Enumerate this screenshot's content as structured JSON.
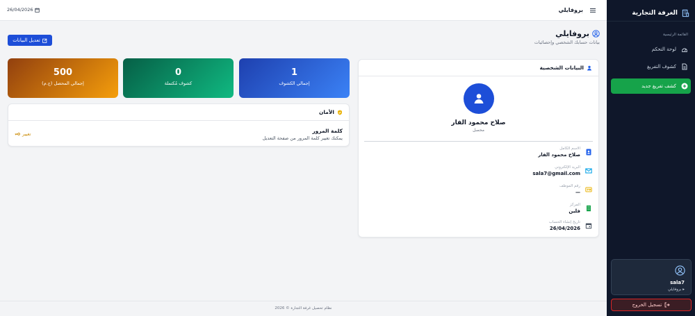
{
  "sidebar": {
    "brand": "الغرفة التجارية",
    "section_label": "القائمة الرئيسية",
    "items": [
      {
        "label": "لوحة التحكم",
        "icon": "dashboard-icon"
      },
      {
        "label": "كشوف التفريغ",
        "icon": "document-icon"
      },
      {
        "label": "كشف تفريغ جديد",
        "icon": "plus-circle-icon"
      }
    ],
    "user": {
      "name": "sala7",
      "profile_link": "بروفايلي"
    },
    "logout_label": "تسجيل الخروج"
  },
  "topbar": {
    "title": "بروفايلي",
    "date": "26/04/2026"
  },
  "page": {
    "title": "بروفايلي",
    "subtitle": "بيانات حسابك الشخصي وإحصائيات",
    "edit_button": "تعديل البيانات"
  },
  "personal": {
    "heading": "البيانات الشخصية",
    "name": "صلاح محمود الفار",
    "role": "محصل",
    "fields": [
      {
        "label": "الاسم الكامل",
        "value": "صلاح محمود الفار",
        "icon": "id-card-icon"
      },
      {
        "label": "البريد الإلكتروني",
        "value": "sala7@gmail.com",
        "icon": "envelope-icon"
      },
      {
        "label": "رقم الموظف",
        "value": "—",
        "icon": "badge-icon"
      },
      {
        "label": "المركز",
        "value": "فلين",
        "icon": "building-icon"
      },
      {
        "label": "تاريخ إنشاء الحساب",
        "value": "26/04/2026",
        "icon": "calendar-icon"
      }
    ]
  },
  "stats": [
    {
      "value": "1",
      "label": "إجمالي الكشوف",
      "color": "#2563eb"
    },
    {
      "value": "0",
      "label": "كشوف مُكتملة",
      "color": "#059669"
    },
    {
      "value": "500",
      "label": "إجمالي المحصل (ج.م)",
      "color": "#d97706"
    }
  ],
  "security": {
    "heading": "الأمان",
    "item_title": "كلمة المرور",
    "item_desc": "يمكنك تغيير كلمة المرور من صفحة التعديل",
    "action": "تغيير"
  },
  "footer": "نظام تحصيل غرفة التجارة © 2026"
}
